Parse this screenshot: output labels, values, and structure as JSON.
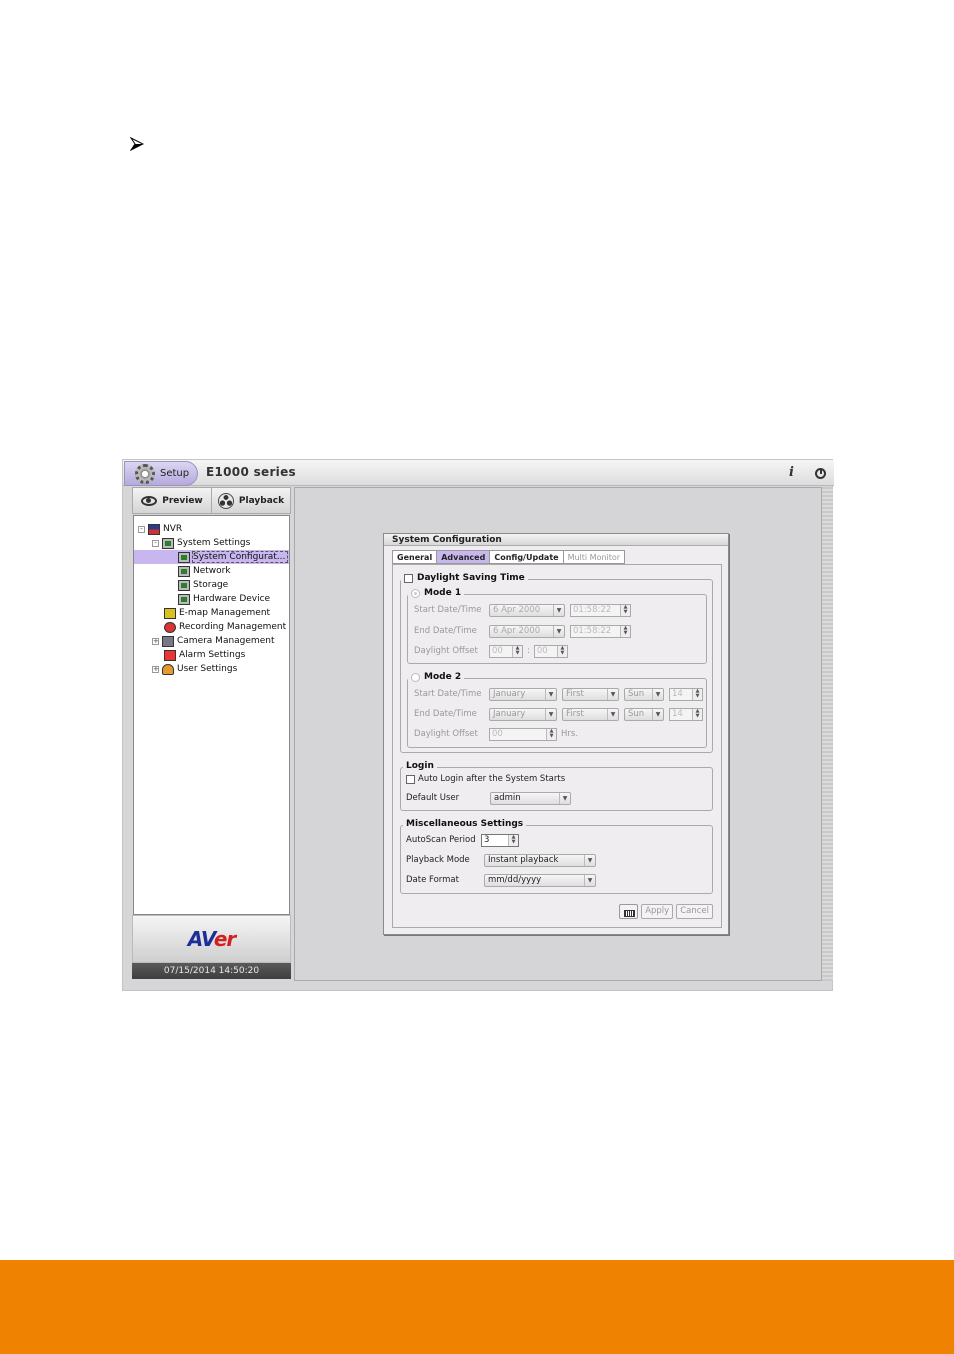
{
  "page": {
    "bullet_icon": "arrow-bullet-icon",
    "footer_color": "#ef8200"
  },
  "app": {
    "setup_tab": "Setup",
    "title": "E1000 series",
    "info_icon": "i",
    "mode_buttons": {
      "preview": "Preview",
      "playback": "Playback"
    },
    "tree": [
      {
        "label": "NVR",
        "icon": "nvr-icon",
        "expander": "-"
      },
      {
        "label": "System Settings",
        "icon": "system-settings-icon",
        "expander": "-"
      },
      {
        "label": "System Configurat...",
        "icon": "monitor-icon",
        "selected": true
      },
      {
        "label": "Network",
        "icon": "monitor-icon"
      },
      {
        "label": "Storage",
        "icon": "monitor-icon"
      },
      {
        "label": "Hardware Device",
        "icon": "monitor-icon"
      },
      {
        "label": "E-map Management",
        "icon": "emap-icon"
      },
      {
        "label": "Recording Management",
        "icon": "recording-icon"
      },
      {
        "label": "Camera Management",
        "icon": "camera-icon",
        "expander": "+"
      },
      {
        "label": "Alarm Settings",
        "icon": "alarm-icon"
      },
      {
        "label": "User Settings",
        "icon": "user-icon",
        "expander": "+"
      }
    ],
    "brand": {
      "main": "AV",
      "accent": "er"
    },
    "clock": "07/15/2014 14:50:20"
  },
  "dialog": {
    "title": "System Configuration",
    "tabs": [
      {
        "label": "General",
        "state": "normal"
      },
      {
        "label": "Advanced",
        "state": "active"
      },
      {
        "label": "Config/Update",
        "state": "normal"
      },
      {
        "label": "Multi Monitor",
        "state": "disabled"
      }
    ],
    "dst": {
      "label": "Daylight Saving Time",
      "checked": false,
      "mode1": {
        "label": "Mode 1",
        "start_label": "Start Date/Time",
        "start_date": "6 Apr 2000",
        "start_time": "01:58:22",
        "end_label": "End Date/Time",
        "end_date": "6 Apr 2000",
        "end_time": "01:58:22",
        "offset_label": "Daylight Offset",
        "offset_h": "00",
        "offset_sep": ":",
        "offset_m": "00"
      },
      "mode2": {
        "label": "Mode 2",
        "start_label": "Start Date/Time",
        "start_month": "January",
        "start_week": "First",
        "start_day": "Sun",
        "start_hour": "14",
        "end_label": "End Date/Time",
        "end_month": "January",
        "end_week": "First",
        "end_day": "Sun",
        "end_hour": "14",
        "offset_label": "Daylight Offset",
        "offset": "00",
        "offset_unit": "Hrs."
      }
    },
    "login": {
      "label": "Login",
      "auto_login_label": "Auto Login after the System Starts",
      "auto_login_checked": false,
      "default_user_label": "Default User",
      "default_user": "admin"
    },
    "misc": {
      "label": "Miscellaneous Settings",
      "autoscan_label": "AutoScan Period",
      "autoscan_value": "3",
      "playback_label": "Playback Mode",
      "playback_value": "Instant playback",
      "date_format_label": "Date Format",
      "date_format_value": "mm/dd/yyyy"
    },
    "buttons": {
      "apply": "Apply",
      "cancel": "Cancel"
    }
  }
}
